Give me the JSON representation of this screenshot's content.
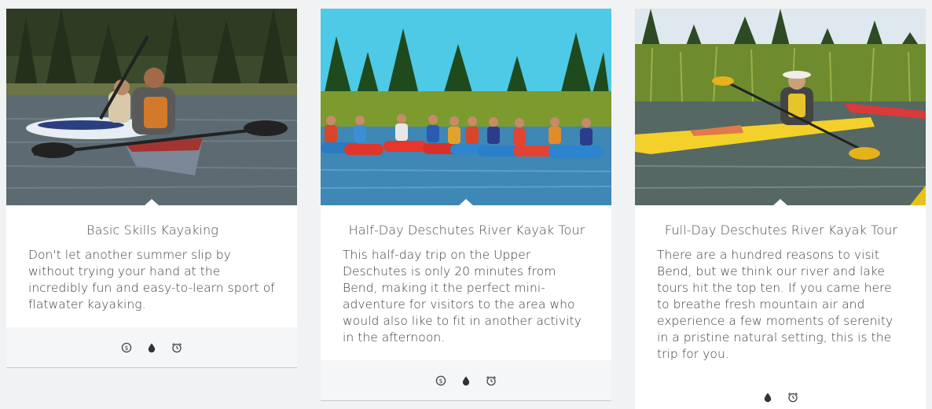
{
  "cards": [
    {
      "title": "Basic Skills Kayaking",
      "description": "Don't let another summer slip by without trying your hand at the incredibly fun and easy-to-learn sport of flatwater kayaking.",
      "icons": [
        "dollar-icon",
        "water-drop-icon",
        "alarm-clock-icon"
      ]
    },
    {
      "title": "Half-Day Deschutes River Kayak Tour",
      "description": "This half-day trip on the Upper Deschutes is only 20 minutes from Bend, making it the perfect mini-adventure for visitors to the area who would also like to fit in another activity in the afternoon.",
      "icons": [
        "dollar-icon",
        "water-drop-icon",
        "alarm-clock-icon"
      ]
    },
    {
      "title": "Full-Day Deschutes River Kayak Tour",
      "description": "There are a hundred reasons to visit Bend, but we think our river and lake tours hit the top ten. If you came here to breathe fresh mountain air and experience a few moments of serenity in a pristine natural setting, this is the trip for you.",
      "icons": [
        "water-drop-icon",
        "alarm-clock-icon"
      ]
    }
  ],
  "colors": {
    "page_background": "#f1f2f3",
    "card_background": "#ffffff",
    "footer_background": "#f5f6f7",
    "icon": "#444444"
  }
}
